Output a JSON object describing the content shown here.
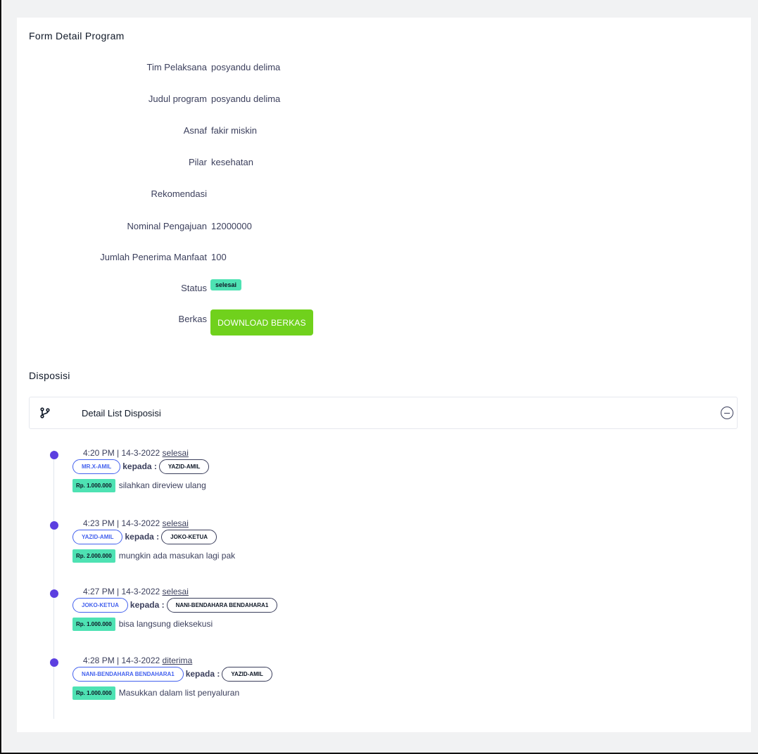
{
  "form": {
    "title": "Form Detail Program",
    "fields": [
      {
        "label": "Tim Pelaksana",
        "value": "posyandu delima"
      },
      {
        "label": "Judul program",
        "value": "posyandu delima"
      },
      {
        "label": "Asnaf",
        "value": "fakir miskin"
      },
      {
        "label": "Pilar",
        "value": "kesehatan"
      },
      {
        "label": "Rekomendasi",
        "value": ""
      },
      {
        "label": "Nominal Pengajuan",
        "value": "12000000"
      },
      {
        "label": "Jumlah Penerima Manfaat",
        "value": "100"
      }
    ],
    "status_label": "Status",
    "status_value": "selesai",
    "berkas_label": "Berkas",
    "download_label": "DOWNLOAD BERKAS",
    "colors": {
      "status_badge": "#4ee2b3",
      "download_button": "#70d11c"
    }
  },
  "disposisi": {
    "title": "Disposisi",
    "accordion_title": "Detail List Disposisi",
    "icons": {
      "header": "git-branch-icon",
      "toggle": "minus-circle-icon"
    },
    "timeline_dot_color": "#5c3fe0",
    "items": [
      {
        "time": "4:20 PM | 14-3-2022",
        "status": "selesai",
        "from": "MR.X-AMIL",
        "kepada": "kepada :",
        "to": "YAZID-AMIL",
        "amount": "Rp. 1.000.000",
        "note": "silahkan direview ulang"
      },
      {
        "time": "4:23 PM | 14-3-2022",
        "status": "selesai",
        "from": "YAZID-AMIL",
        "kepada": "kepada :",
        "to": "JOKO-KETUA",
        "amount": "Rp. 2.000.000",
        "note": "mungkin ada masukan lagi pak"
      },
      {
        "time": "4:27 PM | 14-3-2022",
        "status": "selesai",
        "from": "JOKO-KETUA",
        "kepada": "kepada :",
        "to": "NANI-BENDAHARA BENDAHARA1",
        "amount": "Rp. 1.000.000",
        "note": "bisa langsung dieksekusi"
      },
      {
        "time": "4:28 PM | 14-3-2022",
        "status": "diterima",
        "from": "NANI-BENDAHARA BENDAHARA1",
        "kepada": "kepada :",
        "to": "YAZID-AMIL",
        "amount": "Rp. 1.000.000",
        "note": "Masukkan dalam list penyaluran"
      }
    ]
  }
}
